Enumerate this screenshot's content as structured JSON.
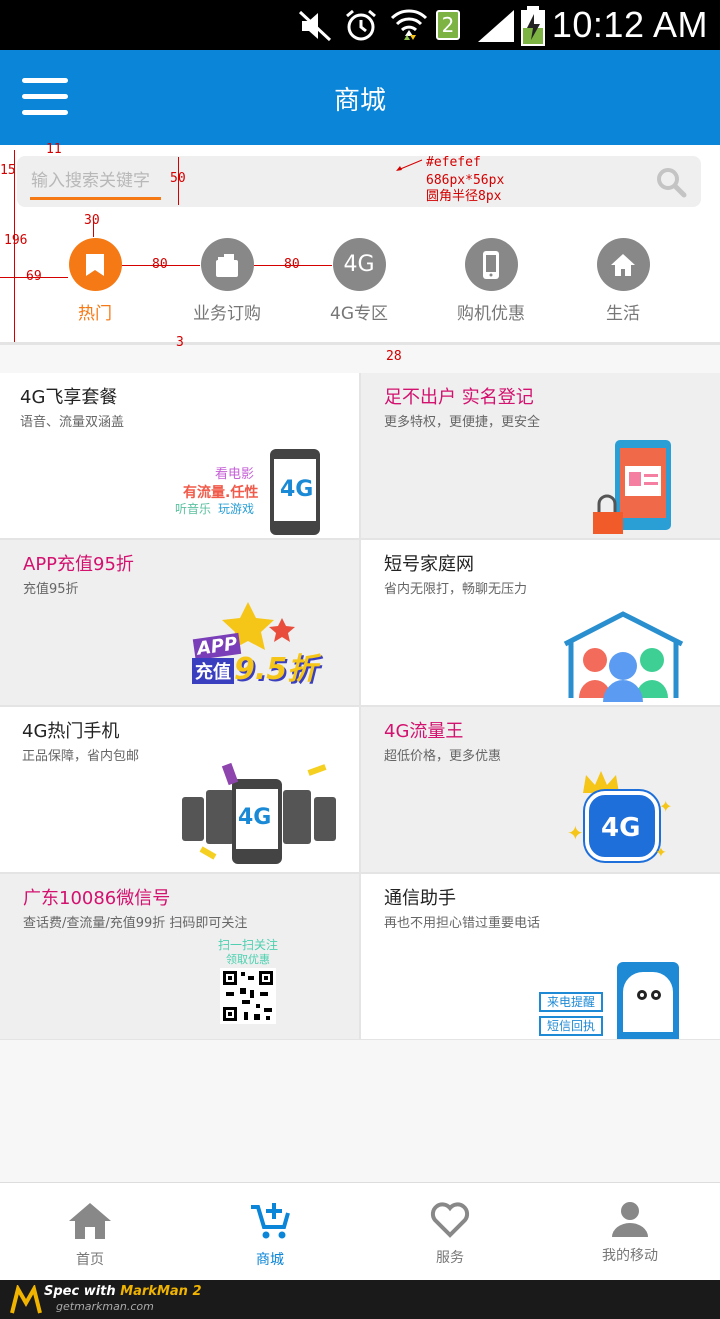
{
  "status_bar": {
    "time": "10:12 AM",
    "sim_badge": "2"
  },
  "header": {
    "title": "商城"
  },
  "search": {
    "placeholder": "输入搜索关键字"
  },
  "nav": [
    {
      "label": "热门",
      "icon": "bookmark-icon",
      "active": true
    },
    {
      "label": "业务订购",
      "icon": "bag-icon",
      "active": false
    },
    {
      "label": "4G专区",
      "icon": "4g-icon",
      "icon_text": "4G",
      "active": false
    },
    {
      "label": "购机优惠",
      "icon": "phone-icon",
      "active": false
    },
    {
      "label": "生活",
      "icon": "home-icon",
      "active": false
    }
  ],
  "annotations": {
    "a11": "11",
    "a15": "15",
    "a50": "50",
    "a196": "196",
    "a30": "30",
    "a69": "69",
    "a80a": "80",
    "a80b": "80",
    "a3": "3",
    "a28": "28",
    "note_color": "#efefef",
    "note_size": "686px*56px",
    "note_radius": "圆角半径8px"
  },
  "cards": [
    {
      "title": "4G飞享套餐",
      "subtitle": "语音、流量双涵盖",
      "art_lines": [
        "看电影",
        "有流量.任性",
        "听音乐",
        "玩游戏"
      ],
      "art_badge": "4G"
    },
    {
      "title": "足不出户 实名登记",
      "subtitle": "更多特权，更便捷，更安全"
    },
    {
      "title": "APP充值95折",
      "subtitle": "充值95折",
      "art_text_a": "APP",
      "art_text_b": "充值",
      "art_text_c": "9.5折"
    },
    {
      "title": "短号家庭网",
      "subtitle": "省内无限打，畅聊无压力"
    },
    {
      "title": "4G热门手机",
      "subtitle": "正品保障，省内包邮",
      "art_badge": "4G"
    },
    {
      "title": "4G流量王",
      "subtitle": "超低价格，更多优惠",
      "art_badge": "4G"
    },
    {
      "title": "广东10086微信号",
      "subtitle": "查话费/查流量/充值99折 扫码即可关注",
      "art_line1": "扫一扫关注",
      "art_line2": "领取优惠"
    },
    {
      "title": "通信助手",
      "subtitle": "再也不用担心错过重要电话",
      "art_tag1": "来电提醒",
      "art_tag2": "短信回执"
    }
  ],
  "tabs": [
    {
      "label": "首页",
      "icon": "home-icon",
      "active": false
    },
    {
      "label": "商城",
      "icon": "cart-icon",
      "active": true
    },
    {
      "label": "服务",
      "icon": "heart-icon",
      "active": false
    },
    {
      "label": "我的移动",
      "icon": "user-icon",
      "active": false
    }
  ],
  "footer": {
    "brand_prefix": "Spec with ",
    "brand_name": "MarkMan 2",
    "site": "getmarkman.com"
  },
  "colors": {
    "primary": "#0b85d8",
    "accent": "#f57a16",
    "pink": "#d3116f",
    "search_bg": "#efefef"
  }
}
